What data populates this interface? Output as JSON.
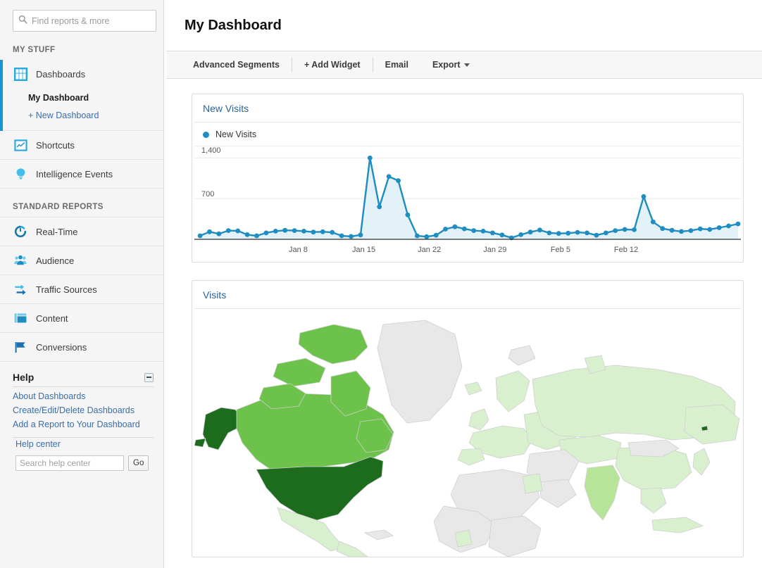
{
  "sidebar": {
    "search": {
      "placeholder": "Find reports & more",
      "value": "",
      "icon": "search-icon"
    },
    "my_stuff_label": "MY STUFF",
    "standard_reports_label": "STANDARD REPORTS",
    "dashboards": {
      "label": "Dashboards",
      "icon": "dashboards-grid-icon",
      "current_dashboard": "My Dashboard",
      "new_dashboard": "+ New Dashboard"
    },
    "my_stuff_items": [
      {
        "label": "Shortcuts",
        "icon": "shortcuts-icon"
      },
      {
        "label": "Intelligence Events",
        "icon": "lightbulb-icon"
      }
    ],
    "standard_items": [
      {
        "label": "Real-Time",
        "icon": "realtime-clock-icon"
      },
      {
        "label": "Audience",
        "icon": "audience-people-icon"
      },
      {
        "label": "Traffic Sources",
        "icon": "traffic-arrows-icon"
      },
      {
        "label": "Content",
        "icon": "content-layout-icon"
      },
      {
        "label": "Conversions",
        "icon": "conversions-flag-icon"
      }
    ],
    "help": {
      "title": "Help",
      "collapse_icon": "minus-collapse-icon",
      "links": [
        "About Dashboards",
        "Create/Edit/Delete Dashboards",
        "Add a Report to Your Dashboard"
      ],
      "help_center": "Help center",
      "search_placeholder": "Search help center",
      "search_value": "",
      "go_label": "Go"
    }
  },
  "header": {
    "title": "My Dashboard"
  },
  "toolbar": {
    "advanced_segments": "Advanced Segments",
    "add_widget": "+ Add Widget",
    "email": "Email",
    "export": "Export"
  },
  "widgets": {
    "new_visits": {
      "title": "New Visits",
      "legend": "New Visits"
    },
    "visits": {
      "title": "Visits"
    }
  },
  "colors": {
    "accent_blue": "#1a94d2",
    "line_blue": "#1f8dc0",
    "area_fill": "#e3f1f9",
    "link_blue": "#2a6496",
    "map_dark_green": "#1d6b1d",
    "map_mid_green": "#3f9e2c",
    "map_light_green": "#6cc24a",
    "map_pale_green": "#d9f0cf",
    "map_no_data": "#e8e8e8"
  },
  "chart_data": {
    "type": "area",
    "title": "New Visits",
    "series": [
      {
        "name": "New Visits",
        "values": [
          60,
          130,
          95,
          150,
          145,
          80,
          60,
          110,
          140,
          155,
          150,
          140,
          125,
          130,
          120,
          60,
          50,
          75,
          1400,
          560,
          1080,
          1010,
          420,
          60,
          45,
          70,
          175,
          215,
          180,
          150,
          140,
          110,
          75,
          25,
          80,
          125,
          160,
          110,
          100,
          105,
          120,
          110,
          70,
          110,
          150,
          170,
          165,
          735,
          300,
          185,
          155,
          135,
          150,
          180,
          170,
          200,
          230,
          265
        ]
      }
    ],
    "x_ticks": [
      "Jan 8",
      "Jan 15",
      "Jan 22",
      "Jan 29",
      "Feb 5",
      "Feb 12"
    ],
    "x_tick_positions": [
      0.115,
      0.235,
      0.355,
      0.475,
      0.595,
      0.715
    ],
    "y_ticks": [
      "700",
      "1,400"
    ],
    "ylim": [
      0,
      1550
    ],
    "grid": true,
    "legend_position": "top-left"
  },
  "map_data": {
    "type": "geo-heatmap",
    "title": "Visits",
    "regions": [
      {
        "name": "United States",
        "shade": "dark"
      },
      {
        "name": "Alaska",
        "shade": "dark"
      },
      {
        "name": "Canada",
        "shade": "light-green"
      },
      {
        "name": "Greenland",
        "shade": "no-data"
      },
      {
        "name": "Mexico",
        "shade": "pale"
      },
      {
        "name": "Europe",
        "shade": "pale"
      },
      {
        "name": "Russia",
        "shade": "pale"
      },
      {
        "name": "China",
        "shade": "pale"
      },
      {
        "name": "India",
        "shade": "pale-plus"
      },
      {
        "name": "Africa",
        "shade": "no-data"
      }
    ]
  }
}
